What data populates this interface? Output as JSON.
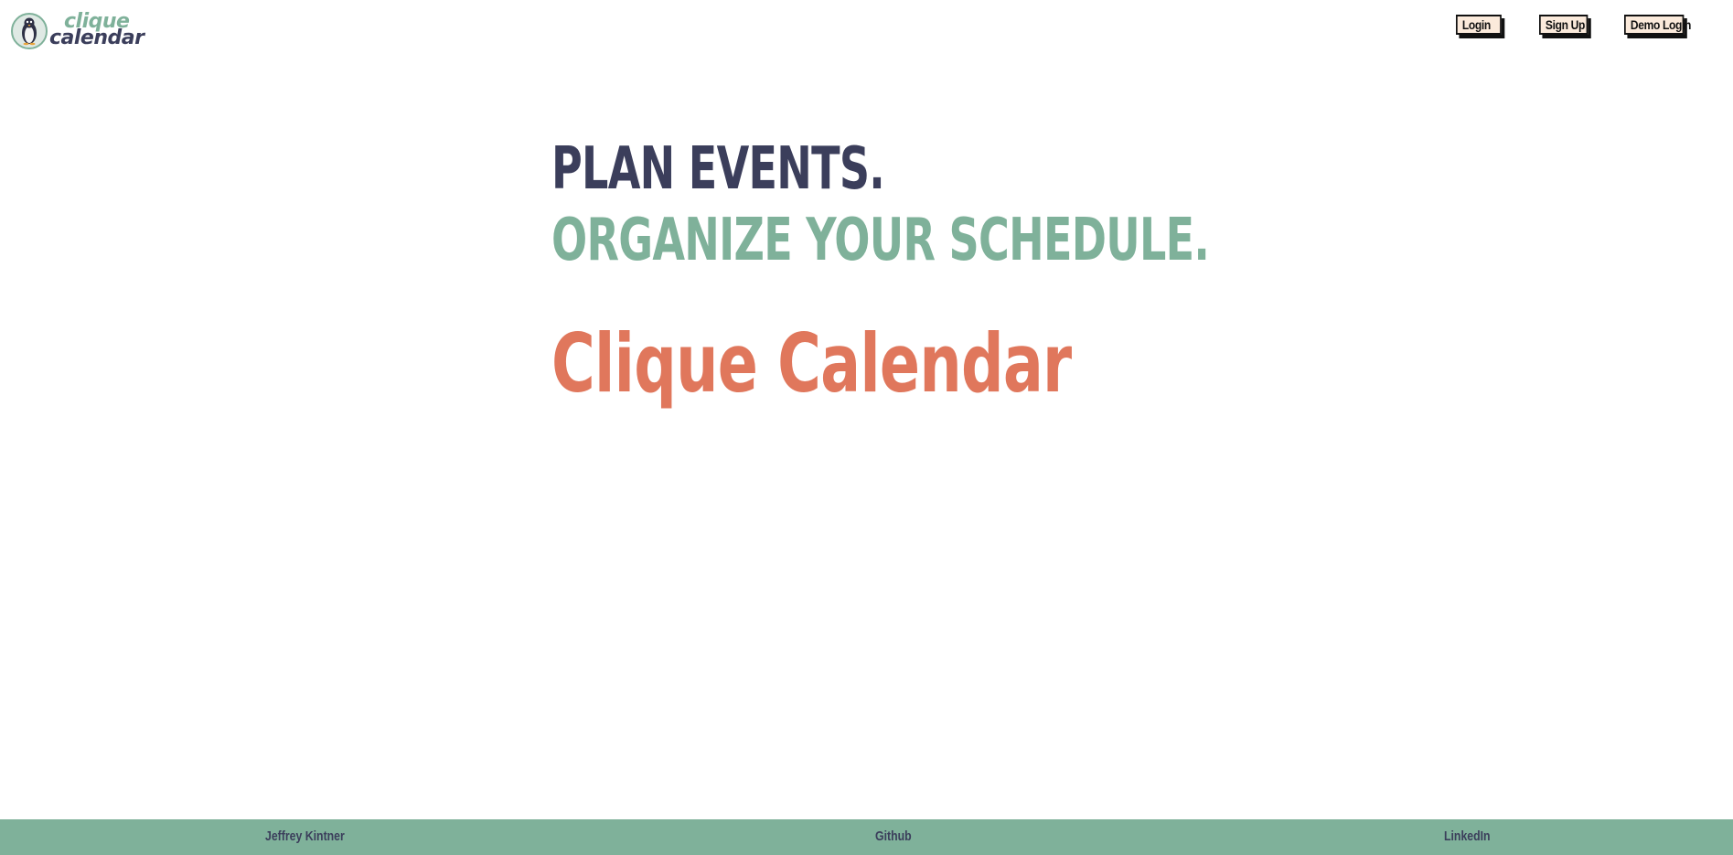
{
  "header": {
    "logo": {
      "icon": "penguin-icon",
      "word1": "clique",
      "word2": "calendar"
    },
    "nav": {
      "login_label": "Login",
      "signup_label": "Sign Up",
      "demo_login_label": "Demo Login"
    }
  },
  "hero": {
    "line1": "PLAN EVENTS.",
    "line2": "ORGANIZE YOUR SCHEDULE.",
    "title": "Clique Calendar"
  },
  "footer": {
    "author": "Jeffrey Kintner",
    "github": "Github",
    "linkedin": "LinkedIn"
  },
  "colors": {
    "navy": "#3b3e5b",
    "sage": "#7fb19a",
    "coral": "#e0775c",
    "button_bg": "#fbeadb"
  }
}
